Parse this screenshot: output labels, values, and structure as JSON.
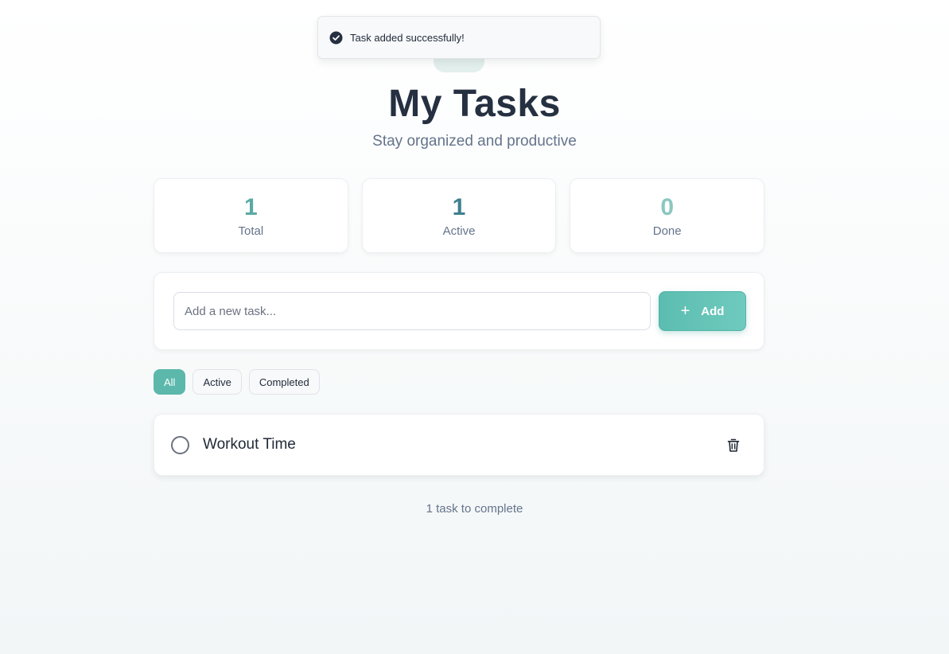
{
  "toast": {
    "icon": "check-circle-icon",
    "message": "Task added successfully!"
  },
  "header": {
    "title": "My Tasks",
    "subtitle": "Stay organized and productive"
  },
  "stats": [
    {
      "value": "1",
      "label": "Total",
      "color": "#5aaaa4"
    },
    {
      "value": "1",
      "label": "Active",
      "color": "#3f7f8f"
    },
    {
      "value": "0",
      "label": "Done",
      "color": "#8cc7c1"
    }
  ],
  "add_task": {
    "placeholder": "Add a new task...",
    "value": "",
    "button_label": "Add",
    "button_icon": "plus-icon"
  },
  "filters": [
    {
      "label": "All",
      "active": true
    },
    {
      "label": "Active",
      "active": false
    },
    {
      "label": "Completed",
      "active": false
    }
  ],
  "tasks": [
    {
      "title": "Workout Time",
      "completed": false,
      "delete_icon": "trash-icon"
    }
  ],
  "footer": {
    "status": "1 task to complete"
  },
  "colors": {
    "accent": "#5bb8ab",
    "title": "#253041",
    "muted": "#64748b"
  }
}
